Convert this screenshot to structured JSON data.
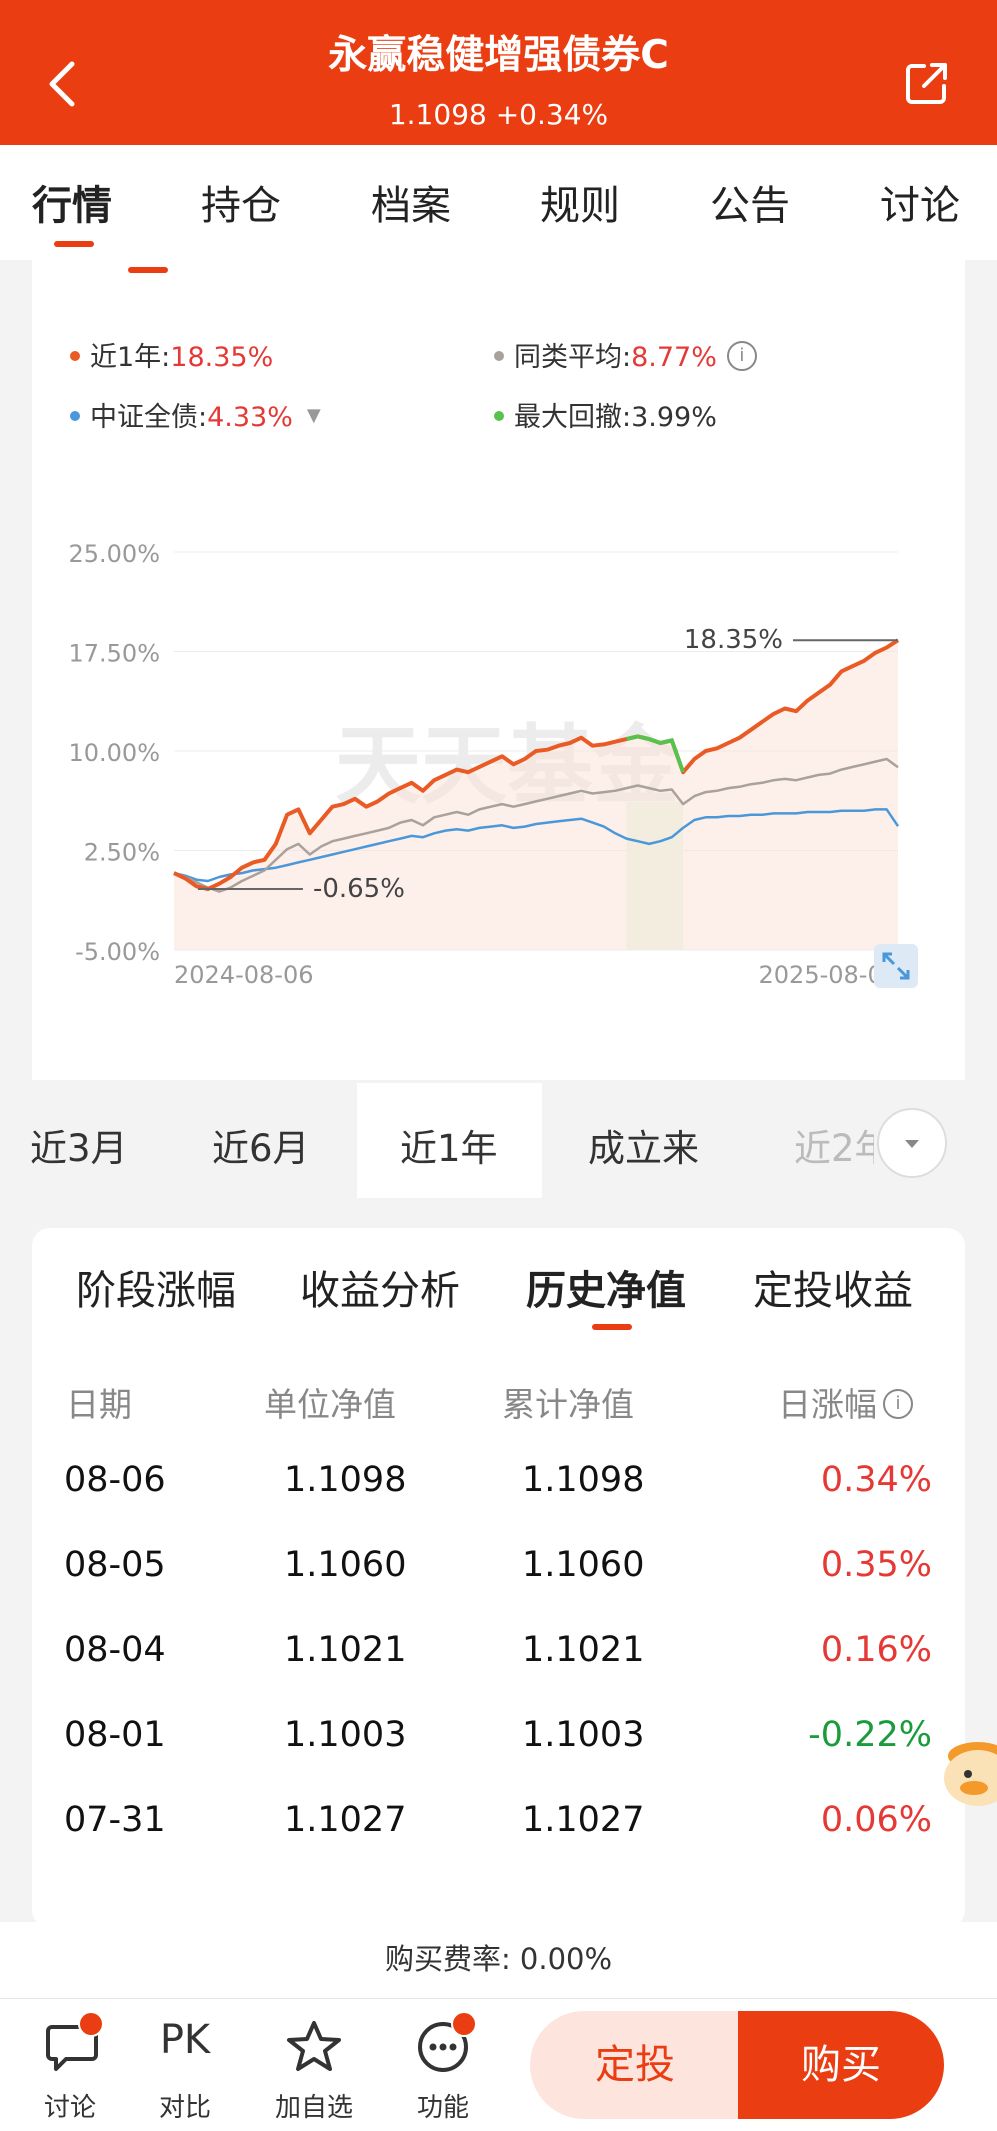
{
  "header": {
    "title": "永赢稳健增强债券C",
    "subtitle": "1.1098 +0.34%",
    "back_icon": "chevron-left-icon",
    "share_icon": "share-icon"
  },
  "tabs": [
    "行情",
    "持仓",
    "档案",
    "规则",
    "公告",
    "讨论"
  ],
  "legend": {
    "one_year_label": "近1年:",
    "one_year_value": "18.35%",
    "peer_label": "同类平均:",
    "peer_value": "8.77%",
    "index_label": "中证全债:",
    "index_value": "4.33%",
    "drawdown_label": "最大回撤:",
    "drawdown_value": "3.99%",
    "info_glyph": "i"
  },
  "colors": {
    "accent": "#ea3d12",
    "fund_line": "#ea5a24",
    "peer_line": "#a9a19c",
    "index_line": "#4a98d9",
    "drawdown_line": "#58c24e",
    "up": "#e53935",
    "down": "#1a9b3c"
  },
  "chart_data": {
    "type": "line",
    "watermark": "天天基金",
    "y_ticks": [
      "25.00%",
      "17.50%",
      "10.00%",
      "2.50%",
      "-5.00%"
    ],
    "ylim": [
      -5,
      25
    ],
    "x_start_label": "2024-08-06",
    "x_end_label": "2025-08-06",
    "annotation_max": "18.35%",
    "annotation_min": "-0.65%",
    "series": [
      {
        "color": "#ea5a24",
        "values": [
          0.8,
          0.4,
          -0.2,
          -0.4,
          0.0,
          0.5,
          1.2,
          1.6,
          1.8,
          3.0,
          5.2,
          5.6,
          3.8,
          4.8,
          5.8,
          6.0,
          6.4,
          5.8,
          6.2,
          6.8,
          7.2,
          7.6,
          7.0,
          7.8,
          8.2,
          8.6,
          8.4,
          8.8,
          9.2,
          9.6,
          9.0,
          9.4,
          10.0,
          10.1,
          10.4,
          10.6,
          11.0,
          10.4,
          10.5,
          10.7,
          10.9,
          11.1,
          10.9,
          10.6,
          10.8,
          8.4,
          9.4,
          10.0,
          10.2,
          10.6,
          11.0,
          11.6,
          12.2,
          12.8,
          13.2,
          13.0,
          13.8,
          14.4,
          15.0,
          16.0,
          16.4,
          16.8,
          17.4,
          17.8,
          18.35
        ]
      },
      {
        "color": "#a9a19c",
        "values": [
          0.8,
          0.5,
          0.1,
          -0.3,
          -0.6,
          -0.3,
          0.2,
          0.6,
          1.0,
          1.8,
          2.6,
          3.0,
          2.2,
          2.8,
          3.2,
          3.4,
          3.6,
          3.8,
          4.0,
          4.2,
          4.6,
          4.8,
          4.4,
          5.0,
          5.2,
          5.4,
          5.2,
          5.6,
          5.8,
          6.0,
          5.8,
          6.0,
          6.2,
          6.4,
          6.6,
          6.8,
          7.0,
          6.8,
          6.9,
          7.0,
          7.2,
          7.4,
          7.2,
          7.0,
          7.1,
          6.0,
          6.6,
          6.9,
          7.0,
          7.2,
          7.3,
          7.5,
          7.6,
          7.8,
          7.9,
          7.8,
          8.0,
          8.2,
          8.3,
          8.6,
          8.8,
          9.0,
          9.2,
          9.4,
          8.77
        ]
      },
      {
        "color": "#4a98d9",
        "values": [
          0.8,
          0.6,
          0.3,
          0.2,
          0.5,
          0.7,
          0.8,
          1.0,
          1.1,
          1.2,
          1.4,
          1.6,
          1.8,
          2.0,
          2.2,
          2.4,
          2.6,
          2.8,
          3.0,
          3.2,
          3.4,
          3.6,
          3.5,
          3.8,
          4.0,
          4.1,
          4.0,
          4.2,
          4.3,
          4.4,
          4.2,
          4.3,
          4.5,
          4.6,
          4.7,
          4.8,
          4.9,
          4.6,
          4.3,
          3.8,
          3.4,
          3.2,
          3.0,
          3.2,
          3.5,
          4.2,
          4.8,
          5.0,
          5.0,
          5.1,
          5.1,
          5.2,
          5.2,
          5.3,
          5.3,
          5.3,
          5.4,
          5.4,
          5.4,
          5.5,
          5.5,
          5.5,
          5.6,
          5.6,
          4.33
        ]
      }
    ],
    "max_drawdown_range": [
      40,
      45
    ]
  },
  "periods": [
    "近3月",
    "近6月",
    "近1年",
    "成立来",
    "近2年"
  ],
  "period_more_icon": "chevron-down-icon",
  "expand_icon": "expand-icon",
  "nav_tabs": [
    "阶段涨幅",
    "收益分析",
    "历史净值",
    "定投收益"
  ],
  "table": {
    "headers": [
      "日期",
      "单位净值",
      "累计净值",
      "日涨幅"
    ],
    "rows": [
      {
        "date": "08-06",
        "unit": "1.1098",
        "acc": "1.1098",
        "chg": "0.34%",
        "dir": "up"
      },
      {
        "date": "08-05",
        "unit": "1.1060",
        "acc": "1.1060",
        "chg": "0.35%",
        "dir": "up"
      },
      {
        "date": "08-04",
        "unit": "1.1021",
        "acc": "1.1021",
        "chg": "0.16%",
        "dir": "up"
      },
      {
        "date": "08-01",
        "unit": "1.1003",
        "acc": "1.1003",
        "chg": "-0.22%",
        "dir": "down"
      },
      {
        "date": "07-31",
        "unit": "1.1027",
        "acc": "1.1027",
        "chg": "0.06%",
        "dir": "up"
      }
    ]
  },
  "fee_text": "购买费率: 0.00%",
  "bottom_nav": {
    "discuss": "讨论",
    "compare": "对比",
    "compare_icon_text": "PK",
    "watch": "加自选",
    "more": "功能"
  },
  "buttons": {
    "dingtou": "定投",
    "buy": "购买"
  }
}
